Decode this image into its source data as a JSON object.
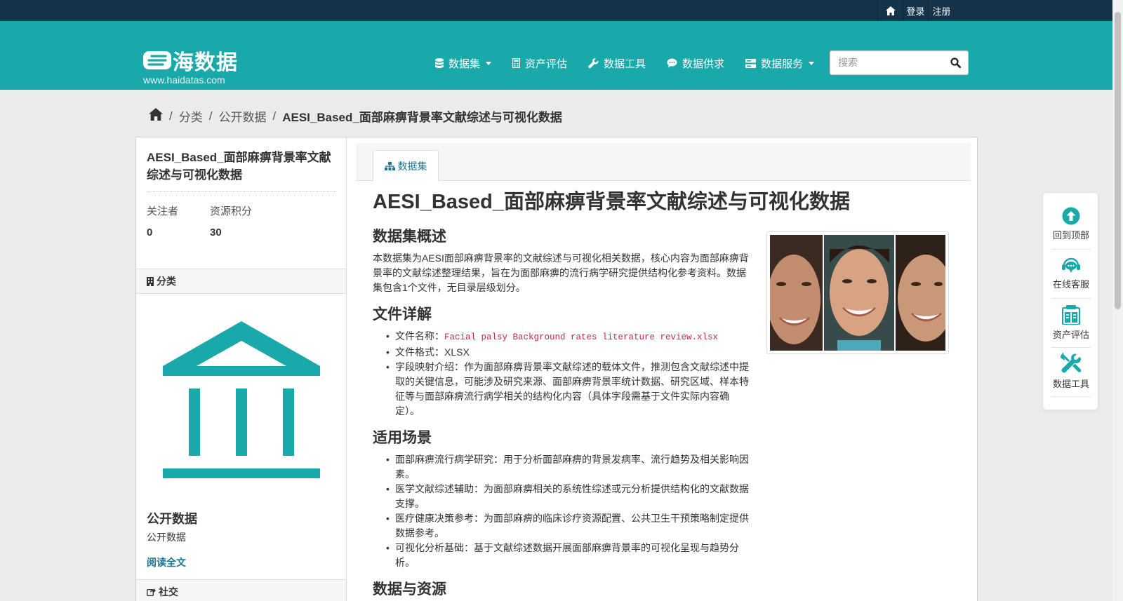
{
  "topbar": {
    "home_icon": "home-icon",
    "login": "登录",
    "register": "注册"
  },
  "header": {
    "logo_text": "海数据",
    "site_url": "www.haidatas.com",
    "nav": [
      {
        "label": "数据集",
        "icon": "database-icon",
        "dropdown": true
      },
      {
        "label": "资产评估",
        "icon": "calculator-icon",
        "dropdown": false
      },
      {
        "label": "数据工具",
        "icon": "wrench-icon",
        "dropdown": false
      },
      {
        "label": "数据供求",
        "icon": "chat-icon",
        "dropdown": false
      },
      {
        "label": "数据服务",
        "icon": "server-icon",
        "dropdown": true
      }
    ],
    "search_placeholder": "搜索"
  },
  "breadcrumb": {
    "items": [
      "分类",
      "公开数据"
    ],
    "current": "AESI_Based_面部麻痹背景率文献综述与可视化数据"
  },
  "aside": {
    "title": "AESI_Based_面部麻痹背景率文献综述与可视化数据",
    "followers_label": "关注者",
    "followers_value": "0",
    "points_label": "资源积分",
    "points_value": "30",
    "category_heading": "分类",
    "category_name": "公开数据",
    "category_desc": "公开数据",
    "read_more": "阅读全文",
    "social_heading": "社交"
  },
  "main": {
    "tab_label": "数据集",
    "title": "AESI_Based_面部麻痹背景率文献综述与可视化数据",
    "overview_heading": "数据集概述",
    "overview_text": "本数据集为AESI面部麻痹背景率的文献综述与可视化相关数据，核心内容为面部麻痹背景率的文献综述整理结果，旨在为面部麻痹的流行病学研究提供结构化参考资料。数据集包含1个文件，无目录层级划分。",
    "files_heading": "文件详解",
    "file_name_label": "文件名称：",
    "file_name_value": "Facial palsy Background rates literature review.xlsx",
    "file_format": "文件格式：XLSX",
    "field_mapping": "字段映射介绍：作为面部麻痹背景率文献综述的载体文件，推测包含文献综述中提取的关键信息，可能涉及研究来源、面部麻痹背景率统计数据、研究区域、样本特征等与面部麻痹流行病学相关的结构化内容（具体字段需基于文件实际内容确定）。",
    "scenarios_heading": "适用场景",
    "scenarios": [
      "面部麻痹流行病学研究：用于分析面部麻痹的背景发病率、流行趋势及相关影响因素。",
      "医学文献综述辅助：为面部麻痹相关的系统性综述或元分析提供结构化的文献数据支撑。",
      "医疗健康决策参考：为面部麻痹的临床诊疗资源配置、公共卫生干预策略制定提供数据参考。",
      "可视化分析基础：基于文献综述数据开展面部麻痹背景率的可视化呈现与趋势分析。"
    ],
    "resources_heading": "数据与资源"
  },
  "float_bar": [
    {
      "label": "回到顶部",
      "icon": "arrow-up-circle-icon"
    },
    {
      "label": "在线客服",
      "icon": "headset-chat-icon"
    },
    {
      "label": "资产评估",
      "icon": "clipboard-icon"
    },
    {
      "label": "数据工具",
      "icon": "tools-icon"
    }
  ],
  "colors": {
    "brand": "#1aa9aa",
    "topbar": "#15344a",
    "link": "#187794",
    "code": "#c7254e"
  }
}
